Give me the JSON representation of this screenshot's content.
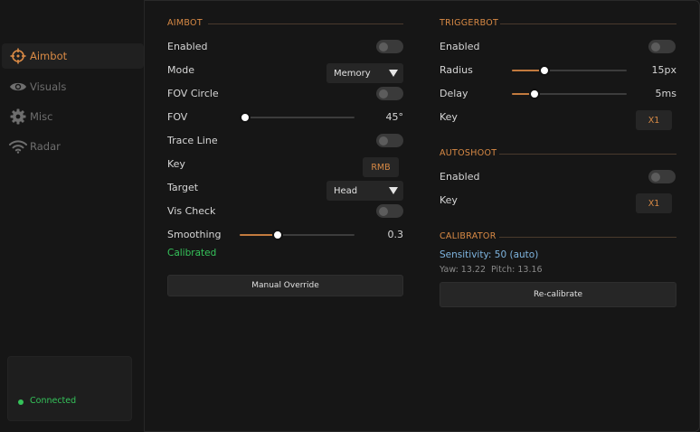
{
  "sidebar": {
    "items": [
      {
        "label": "Aimbot",
        "icon": "crosshair-icon",
        "active": true
      },
      {
        "label": "Visuals",
        "icon": "eye-icon",
        "active": false
      },
      {
        "label": "Misc",
        "icon": "gear-icon",
        "active": false
      },
      {
        "label": "Radar",
        "icon": "wifi-icon",
        "active": false
      }
    ],
    "status": {
      "text": "Connected",
      "color": "#35c35a"
    }
  },
  "aimbot": {
    "title": "AIMBOT",
    "enabled_label": "Enabled",
    "mode_label": "Mode",
    "mode_value": "Memory",
    "fov_circle_label": "FOV Circle",
    "fov_label": "FOV",
    "fov_value": "45°",
    "fov_fraction": 0.0,
    "trace_line_label": "Trace Line",
    "key_label": "Key",
    "key_value": "RMB",
    "target_label": "Target",
    "target_value": "Head",
    "vis_check_label": "Vis Check",
    "smoothing_label": "Smoothing",
    "smoothing_value": "0.3",
    "smoothing_fraction": 0.33,
    "calibrated_text": "Calibrated",
    "manual_override_label": "Manual Override"
  },
  "triggerbot": {
    "title": "TRIGGERBOT",
    "enabled_label": "Enabled",
    "radius_label": "Radius",
    "radius_value": "15px",
    "radius_fraction": 0.28,
    "delay_label": "Delay",
    "delay_value": "5ms",
    "delay_fraction": 0.2,
    "key_label": "Key",
    "key_value": "X1"
  },
  "autoshoot": {
    "title": "AUTOSHOOT",
    "enabled_label": "Enabled",
    "key_label": "Key",
    "key_value": "X1"
  },
  "calibrator": {
    "title": "CALIBRATOR",
    "sensitivity_text": "Sensitivity: 50 (auto)",
    "yaw_pitch_text": "Yaw: 13.22  Pitch: 13.16",
    "recalibrate_label": "Re-calibrate"
  },
  "colors": {
    "accent": "#d98a45",
    "success": "#35c35a",
    "info": "#7fb5e0"
  }
}
